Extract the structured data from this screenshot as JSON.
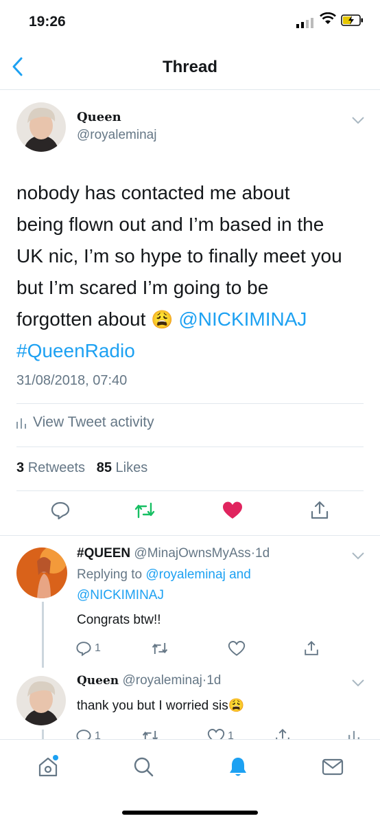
{
  "status_bar": {
    "time": "19:26"
  },
  "nav": {
    "title": "Thread"
  },
  "main_tweet": {
    "display_name": "Queen",
    "handle": "@royaleminaj",
    "text_line1": "nobody has contacted me about",
    "text_line2": "being flown out and I’m based in the",
    "text_line3": "UK nic, I’m so hype to finally meet you",
    "text_line4": "but I’m scared I’m going to be",
    "text_line5_prefix": "forgotten about",
    "emoji": "😩",
    "mention": "@NICKIMINAJ",
    "hashtag": "#QueenRadio",
    "timestamp": "31/08/2018, 07:40",
    "activity_label": "View Tweet activity",
    "retweets_count": "3",
    "retweets_label": "Retweets",
    "likes_count": "85",
    "likes_label": "Likes"
  },
  "replies": [
    {
      "display_name": "#QUEEN",
      "handle": "@MinajOwnsMyAss",
      "separator": "·",
      "time": "1d",
      "replying_prefix": "Replying to",
      "replying_user1": "@royaleminaj",
      "replying_and": "and",
      "replying_user2": "@NICKIMINAJ",
      "text": "Congrats btw!!",
      "reply_count": "1",
      "retweet_count": "",
      "like_count": ""
    },
    {
      "display_name": "Queen",
      "handle": "@royaleminaj",
      "separator": "·",
      "time": "1d",
      "text": "thank you but I worried sis",
      "emoji": "😩",
      "reply_count": "1",
      "like_count": "1"
    }
  ],
  "tab_bar": {
    "items": [
      "home-icon",
      "search-icon",
      "notifications-icon",
      "messages-icon"
    ],
    "active": "notifications-icon"
  },
  "colors": {
    "accent": "#1da1f2",
    "like": "#e0245e",
    "retweet": "#17bf63",
    "muted": "#657786"
  }
}
